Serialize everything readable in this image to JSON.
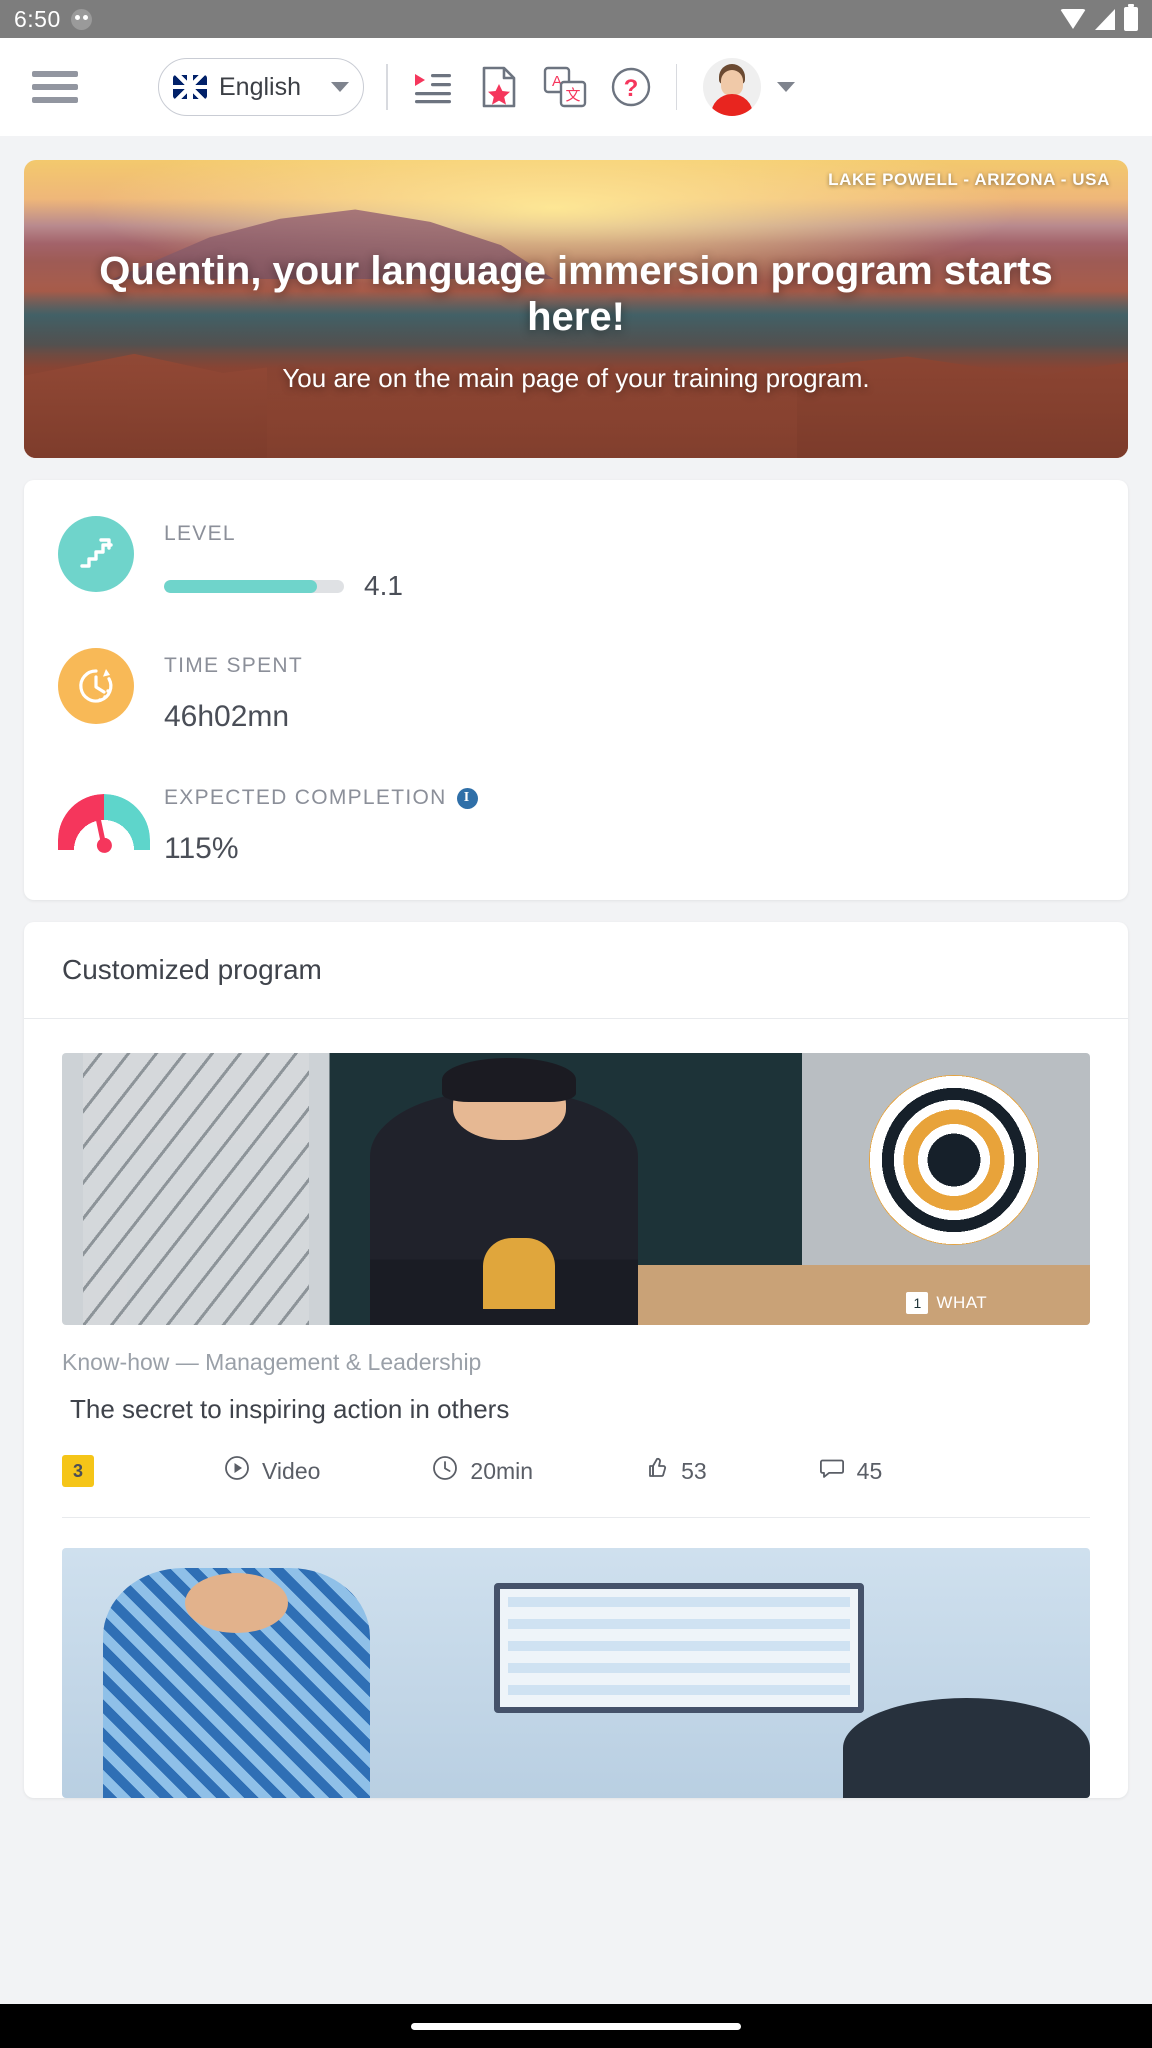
{
  "statusbar": {
    "time": "6:50",
    "icons": [
      "app-chip-icon",
      "wifi-icon",
      "signal-icon",
      "battery-icon"
    ]
  },
  "appbar": {
    "menu_icon": "hamburger-menu-icon",
    "language": {
      "label": "English",
      "flag": "uk-flag-icon",
      "caret": "chevron-down-icon"
    },
    "tools": [
      {
        "name": "playlist-icon"
      },
      {
        "name": "starred-document-icon"
      },
      {
        "name": "translate-icon"
      },
      {
        "name": "help-icon"
      }
    ],
    "avatar": {
      "name": "user-avatar",
      "caret": "chevron-down-icon"
    }
  },
  "hero": {
    "caption": "LAKE POWELL - ARIZONA - USA",
    "title": "Quentin, your language immersion program starts here!",
    "subtitle": "You are on the main page of your training program."
  },
  "stats": [
    {
      "id": "level",
      "label": "LEVEL",
      "value": "4.1",
      "icon": "stairs-growth-icon",
      "progress_percent": 85,
      "accent": "#6fd4cb"
    },
    {
      "id": "time-spent",
      "label": "TIME SPENT",
      "value": "46h02mn",
      "icon": "clock-icon",
      "accent": "#f8b957"
    },
    {
      "id": "expected-completion",
      "label": "EXPECTED COMPLETION",
      "value": "115%",
      "icon": "gauge-icon",
      "info": "i",
      "accent": "#f5365c"
    }
  ],
  "program": {
    "heading": "Customized program",
    "courses": [
      {
        "category": "Know-how — Management & Leadership",
        "title": "The secret to inspiring action in others",
        "badge": "3",
        "type_icon": "play-circle-icon",
        "type": "Video",
        "duration_icon": "clock-icon",
        "duration": "20min",
        "likes_icon": "thumbs-up-icon",
        "likes": "53",
        "comments_icon": "comment-icon",
        "comments": "45",
        "thumbnail_overlay": {
          "number": "1",
          "text": "WHAT"
        }
      },
      {
        "category": "",
        "title": "",
        "thumbnail_only": true
      }
    ]
  },
  "navbar": {
    "pill": "home-indicator"
  },
  "colors": {
    "teal": "#6fd4cb",
    "orange": "#f8b957",
    "pink": "#f5365c",
    "yellow": "#f5c518",
    "text": "#4a4e57",
    "muted": "#8b8f99"
  }
}
